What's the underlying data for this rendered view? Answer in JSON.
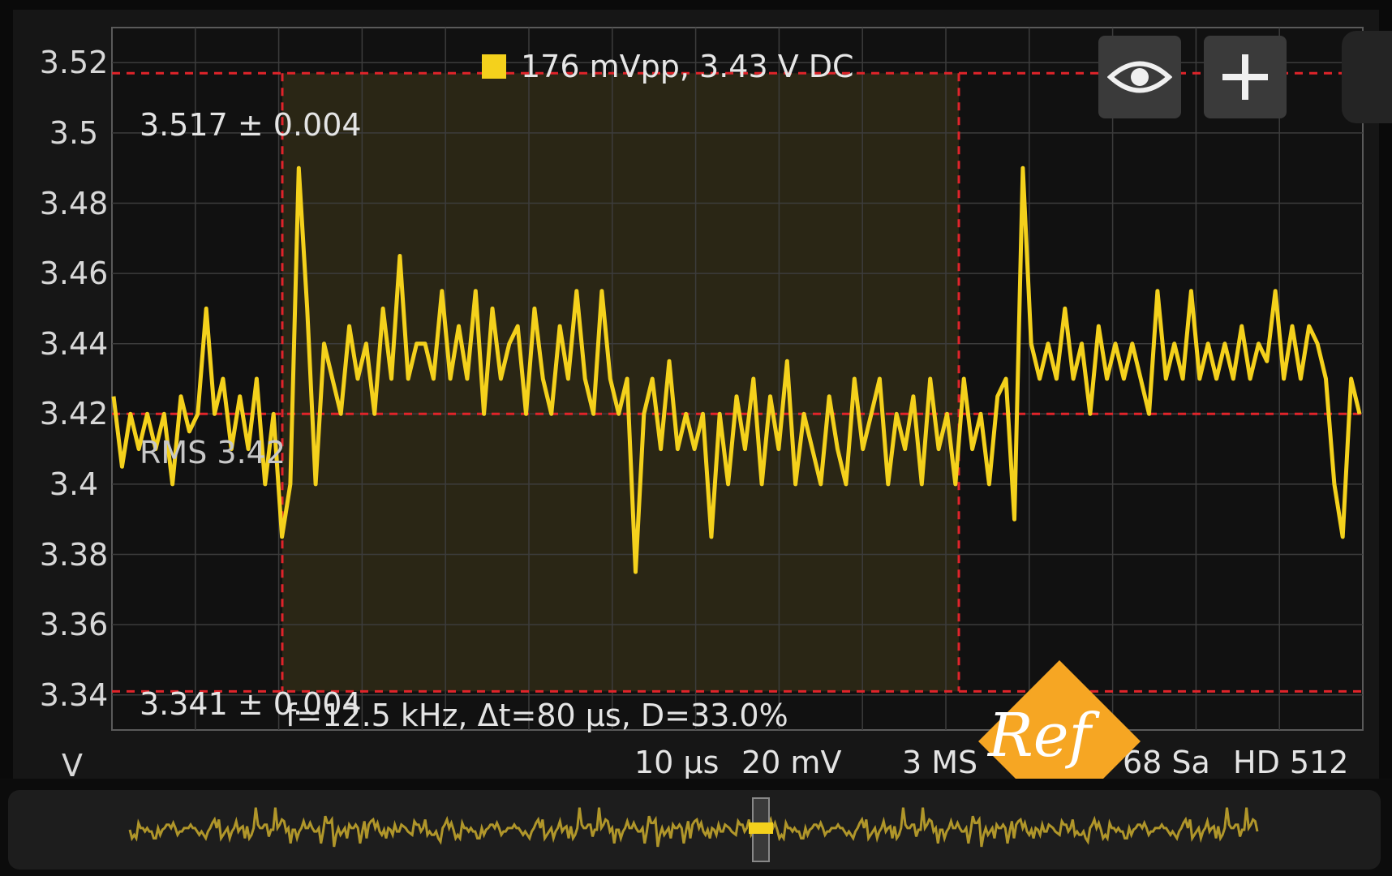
{
  "scope": {
    "legend": {
      "text": "176 mVpp, 3.43 V DC",
      "color": "#f4d11c"
    },
    "axis": {
      "unit": "V",
      "y_ticks": [
        "3.52",
        "3.5",
        "3.48",
        "3.46",
        "3.44",
        "3.42",
        "3.4",
        "3.38",
        "3.36",
        "3.34"
      ]
    },
    "cursors": {
      "upper_label": "3.517 ± 0.004",
      "lower_label": "3.341 ± 0.004",
      "rms_label": "RMS 3.42",
      "timing_label": "f=12.5 kHz, Δt=80 μs, D=33.0%",
      "upper_level": 3.517,
      "lower_level": 3.341,
      "rms_level": 3.42
    },
    "status": {
      "timebase": "10 μs",
      "volts_per_div": "20 mV",
      "sample_rate_part": "3 MS",
      "samples_part": "68 Sa",
      "mode_part": "HD 512"
    },
    "buttons": {
      "visibility_icon": "eye-icon",
      "add_icon": "plus-icon"
    },
    "logo": {
      "text": "Ref",
      "color": "#f6a623"
    },
    "colors": {
      "trace": "#f4d11c",
      "cursor": "#e0242a",
      "highlight": "#2a2615",
      "grid": "#3c3c3c"
    }
  },
  "chart_data": {
    "type": "line",
    "title": "",
    "xlabel": "",
    "ylabel": "V",
    "ylim": [
      3.33,
      3.53
    ],
    "series": [
      {
        "name": "176 mVpp, 3.43 V DC",
        "x": [
          0,
          1,
          2,
          3,
          4,
          5,
          6,
          7,
          8,
          9,
          10,
          11,
          12,
          13,
          14,
          15,
          16,
          17,
          18,
          19,
          20,
          21,
          22,
          23,
          24,
          25,
          26,
          27,
          28,
          29,
          30,
          31,
          32,
          33,
          34,
          35,
          36,
          37,
          38,
          39,
          40,
          41,
          42,
          43,
          44,
          45,
          46,
          47,
          48,
          49,
          50,
          51,
          52,
          53,
          54,
          55,
          56,
          57,
          58,
          59,
          60,
          61,
          62,
          63,
          64,
          65,
          66,
          67,
          68,
          69,
          70,
          71,
          72,
          73,
          74,
          75,
          76,
          77,
          78,
          79,
          80,
          81,
          82,
          83,
          84,
          85,
          86,
          87,
          88,
          89,
          90,
          91,
          92,
          93,
          94,
          95,
          96,
          97,
          98,
          99,
          100,
          101,
          102,
          103,
          104,
          105,
          106,
          107,
          108,
          109,
          110,
          111,
          112,
          113,
          114,
          115,
          116,
          117,
          118,
          119,
          120,
          121,
          122,
          123,
          124,
          125,
          126,
          127,
          128,
          129,
          130,
          131,
          132,
          133,
          134,
          135,
          136,
          137,
          138,
          139,
          140,
          141,
          142,
          143,
          144,
          145,
          146,
          147,
          148
        ],
        "values": [
          3.425,
          3.405,
          3.42,
          3.41,
          3.42,
          3.41,
          3.42,
          3.4,
          3.425,
          3.415,
          3.42,
          3.45,
          3.42,
          3.43,
          3.41,
          3.425,
          3.41,
          3.43,
          3.4,
          3.42,
          3.385,
          3.4,
          3.49,
          3.45,
          3.4,
          3.44,
          3.43,
          3.42,
          3.445,
          3.43,
          3.44,
          3.42,
          3.45,
          3.43,
          3.465,
          3.43,
          3.44,
          3.44,
          3.43,
          3.455,
          3.43,
          3.445,
          3.43,
          3.455,
          3.42,
          3.45,
          3.43,
          3.44,
          3.445,
          3.42,
          3.45,
          3.43,
          3.42,
          3.445,
          3.43,
          3.455,
          3.43,
          3.42,
          3.455,
          3.43,
          3.42,
          3.43,
          3.375,
          3.42,
          3.43,
          3.41,
          3.435,
          3.41,
          3.42,
          3.41,
          3.42,
          3.385,
          3.42,
          3.4,
          3.425,
          3.41,
          3.43,
          3.4,
          3.425,
          3.41,
          3.435,
          3.4,
          3.42,
          3.41,
          3.4,
          3.425,
          3.41,
          3.4,
          3.43,
          3.41,
          3.42,
          3.43,
          3.4,
          3.42,
          3.41,
          3.425,
          3.4,
          3.43,
          3.41,
          3.42,
          3.4,
          3.43,
          3.41,
          3.42,
          3.4,
          3.425,
          3.43,
          3.39,
          3.49,
          3.44,
          3.43,
          3.44,
          3.43,
          3.45,
          3.43,
          3.44,
          3.42,
          3.445,
          3.43,
          3.44,
          3.43,
          3.44,
          3.43,
          3.42,
          3.455,
          3.43,
          3.44,
          3.43,
          3.455,
          3.43,
          3.44,
          3.43,
          3.44,
          3.43,
          3.445,
          3.43,
          3.44,
          3.435,
          3.455,
          3.43,
          3.445,
          3.43,
          3.445,
          3.44,
          3.43,
          3.4,
          3.385,
          3.43,
          3.42
        ]
      }
    ]
  }
}
